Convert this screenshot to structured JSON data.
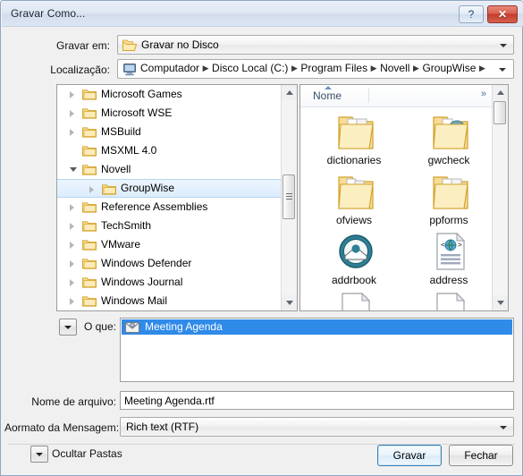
{
  "window": {
    "title": "Gravar Como...",
    "help_label": "?",
    "close_label": "✕"
  },
  "toolbar": {
    "save_in_label": "Gravar em:",
    "save_in_value": "Gravar no Disco",
    "location_label": "Localização:",
    "breadcrumb": [
      "Computador",
      "Disco Local (C:)",
      "Program Files",
      "Novell",
      "GroupWise"
    ]
  },
  "tree": {
    "items": [
      {
        "label": "Microsoft Games",
        "indent": 0,
        "expander": "collapsed",
        "selected": false
      },
      {
        "label": "Microsoft WSE",
        "indent": 0,
        "expander": "collapsed",
        "selected": false
      },
      {
        "label": "MSBuild",
        "indent": 0,
        "expander": "collapsed",
        "selected": false
      },
      {
        "label": "MSXML 4.0",
        "indent": 0,
        "expander": "none",
        "selected": false
      },
      {
        "label": "Novell",
        "indent": 0,
        "expander": "expanded",
        "selected": false
      },
      {
        "label": "GroupWise",
        "indent": 1,
        "expander": "collapsed",
        "selected": true
      },
      {
        "label": "Reference Assemblies",
        "indent": 0,
        "expander": "collapsed",
        "selected": false
      },
      {
        "label": "TechSmith",
        "indent": 0,
        "expander": "collapsed",
        "selected": false
      },
      {
        "label": "VMware",
        "indent": 0,
        "expander": "collapsed",
        "selected": false
      },
      {
        "label": "Windows Defender",
        "indent": 0,
        "expander": "collapsed",
        "selected": false
      },
      {
        "label": "Windows Journal",
        "indent": 0,
        "expander": "collapsed",
        "selected": false
      },
      {
        "label": "Windows Mail",
        "indent": 0,
        "expander": "collapsed",
        "selected": false
      }
    ]
  },
  "filelist": {
    "column_header": "Nome",
    "sort": "ascending",
    "overflow_label": "»",
    "items": [
      {
        "label": "dictionaries",
        "icon": "folder-docs-icon"
      },
      {
        "label": "gwcheck",
        "icon": "folder-disc-icon"
      },
      {
        "label": "ofviews",
        "icon": "folder-files-icon"
      },
      {
        "label": "ppforms",
        "icon": "folder-docs-icon"
      },
      {
        "label": "addrbook",
        "icon": "address-book-icon"
      },
      {
        "label": "address",
        "icon": "html-document-icon"
      }
    ]
  },
  "form": {
    "what_label": "O que:",
    "what_selected_item": "Meeting Agenda",
    "filename_label": "Nome de arquivo:",
    "filename_value": "Meeting Agenda.rtf",
    "format_label": "Aormato da Mensagem:",
    "format_value": "Rich text (RTF)"
  },
  "footer": {
    "hide_folders_label": "Ocultar Pastas",
    "save_button": "Gravar",
    "close_button": "Fechar"
  },
  "colors": {
    "title_bar": "#dde7f3",
    "selection_blue": "#2f8ae8",
    "close_red": "#c43b2a",
    "default_button_border": "#3c7fb1",
    "folder_yellow": "#f6d278"
  }
}
